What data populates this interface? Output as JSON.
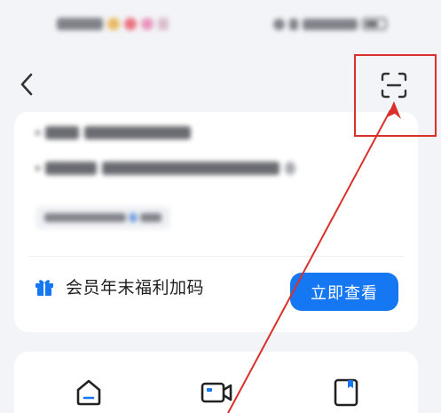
{
  "nav": {
    "back_icon": "chevron-left-icon",
    "scan_icon": "scan-icon"
  },
  "benefits": {
    "items_obscured": 3
  },
  "promo": {
    "icon": "gift-icon",
    "title": "会员年末福利加码",
    "button_label": "立即查看"
  },
  "tools": [
    {
      "icon": "home-icon"
    },
    {
      "icon": "video-camera-icon"
    },
    {
      "icon": "document-icon"
    }
  ],
  "annotation": {
    "highlight_color": "#d9302a"
  },
  "colors": {
    "accent": "#1577f2",
    "background": "#f3f4f7",
    "card": "#ffffff"
  }
}
